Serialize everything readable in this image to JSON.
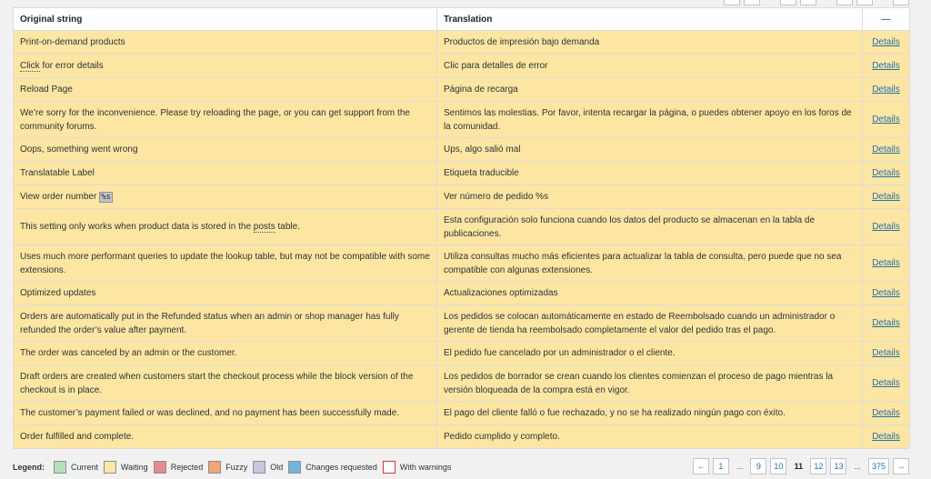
{
  "header": {
    "original": "Original string",
    "translation": "Translation",
    "actions": "—"
  },
  "action_label": "Details",
  "rows": [
    {
      "original": "Print-on-demand products",
      "translation": "Productos de impresión bajo demanda"
    },
    {
      "original_dotted": "Click",
      "original_rest": " for error details",
      "translation": "Clic para detalles de error"
    },
    {
      "original": "Reload Page",
      "translation": "Página de recarga"
    },
    {
      "original": "We’re sorry for the inconvenience. Please try reloading the page, or you can get support from the community forums.",
      "translation": "Sentimos las molestias. Por favor, intenta recargar la página, o puedes obtener apoyo en los foros de la comunidad."
    },
    {
      "original": "Oops, something went wrong",
      "translation": "Ups, algo salió mal"
    },
    {
      "original": "Translatable Label",
      "translation": "Etiqueta traducible"
    },
    {
      "original_prefix": "View order number ",
      "original_placeholder": "%s",
      "translation": "Ver número de pedido %s"
    },
    {
      "original_prefix": "This setting only works when product data is stored in the ",
      "original_dotted": "posts",
      "original_rest": " table.",
      "translation": "Esta configuración solo funciona cuando los datos del producto se almacenan en la tabla de publicaciones."
    },
    {
      "original": "Uses much more performant queries to update the lookup table, but may not be compatible with some extensions.",
      "translation": "Utiliza consultas mucho más eficientes para actualizar la tabla de consulta, pero puede que no sea compatible con algunas extensiones."
    },
    {
      "original": "Optimized updates",
      "translation": "Actualizaciones optimizadas"
    },
    {
      "original": "Orders are automatically put in the Refunded status when an admin or shop manager has fully refunded the order’s value after payment.",
      "translation": "Los pedidos se colocan automáticamente en estado de Reembolsado cuando un administrador o gerente de tienda ha reembolsado completamente el valor del pedido tras el pago."
    },
    {
      "original": "The order was canceled by an admin or the customer.",
      "translation": "El pedido fue cancelado por un administrador o el cliente."
    },
    {
      "original": "Draft orders are created when customers start the checkout process while the block version of the checkout is in place.",
      "translation": "Los pedidos de borrador se crean cuando los clientes comienzan el proceso de pago mientras la versión bloqueada de la compra está en vigor."
    },
    {
      "original": "The customer’s payment failed or was declined, and no payment has been successfully made.",
      "translation": "El pago del cliente falló o fue rechazado, y no se ha realizado ningún pago con éxito."
    },
    {
      "original": "Order fulfilled and complete.",
      "translation": "Pedido cumplido y completo."
    }
  ],
  "legend": {
    "title": "Legend:",
    "items": [
      "Current",
      "Waiting",
      "Rejected",
      "Fuzzy",
      "Old",
      "Changes requested",
      "With warnings"
    ]
  },
  "pagination": {
    "prev": "←",
    "first": "1",
    "dots": "...",
    "p9": "9",
    "p10": "10",
    "current": "11",
    "p12": "12",
    "p13": "13",
    "last": "375",
    "next": "→"
  },
  "colors": {
    "waiting_row": "#fde6a2",
    "link": "#2271b1"
  }
}
